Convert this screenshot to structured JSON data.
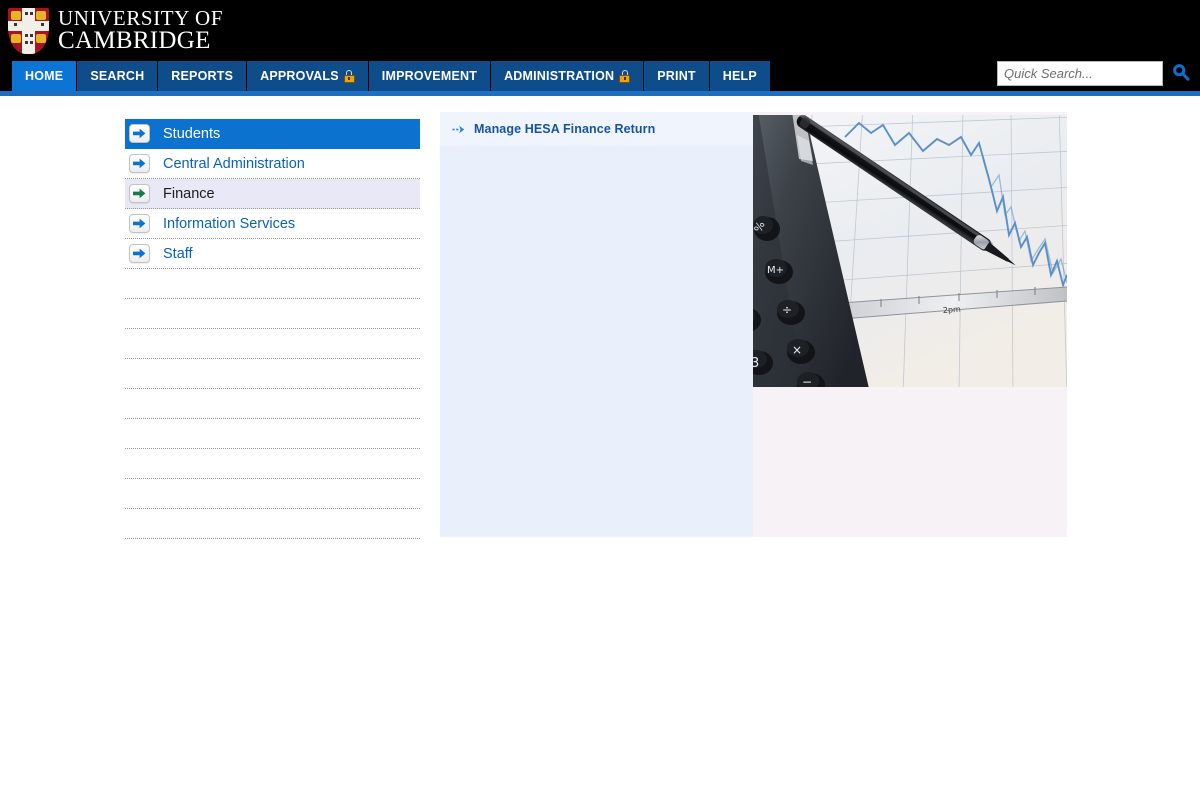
{
  "header": {
    "logo_icon": "cambridge-crest-icon",
    "wordmark_line1": "UNIVERSITY OF",
    "wordmark_line2": "CAMBRIDGE"
  },
  "search": {
    "placeholder": "Quick Search...",
    "value": "",
    "icon": "search-icon"
  },
  "nav": {
    "tabs": [
      {
        "label": "HOME",
        "active": true,
        "locked": false
      },
      {
        "label": "SEARCH",
        "active": false,
        "locked": false
      },
      {
        "label": "REPORTS",
        "active": false,
        "locked": false
      },
      {
        "label": "APPROVALS",
        "active": false,
        "locked": true
      },
      {
        "label": "IMPROVEMENT",
        "active": false,
        "locked": false
      },
      {
        "label": "ADMINISTRATION",
        "active": false,
        "locked": true
      },
      {
        "label": "PRINT",
        "active": false,
        "locked": false
      },
      {
        "label": "HELP",
        "active": false,
        "locked": false
      }
    ]
  },
  "sidebar": {
    "items": [
      {
        "label": "Students",
        "state": "selected"
      },
      {
        "label": "Central Administration",
        "state": "normal"
      },
      {
        "label": "Finance",
        "state": "hovered"
      },
      {
        "label": "Information Services",
        "state": "normal"
      },
      {
        "label": "Staff",
        "state": "normal"
      }
    ],
    "empty_rows": 9
  },
  "middle_panel": {
    "items": [
      {
        "label": "Manage HESA Finance Return",
        "icon": "dashed-arrow-icon"
      }
    ]
  },
  "right_panel": {
    "image_alt": "calculator-and-pen-on-financial-chart-photo"
  },
  "colors": {
    "header_background": "#000000",
    "nav_tab": "#0f4c8a",
    "nav_tab_active": "#0b74d4",
    "blue_strip": "#1c6fc2",
    "sidebar_selected": "#0b72d0",
    "sidebar_hover": "#e8e8f6",
    "link_blue": "#0a62b8",
    "middle_panel_background": "#eaf0fb",
    "right_panel_background": "#f6f2f6",
    "lock_gold": "#e8a317"
  }
}
